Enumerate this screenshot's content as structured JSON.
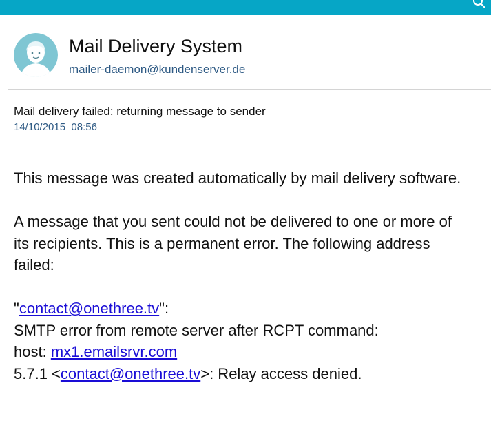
{
  "app_bar": {
    "color": "#06a6c6",
    "icon": "search-icon"
  },
  "sender": {
    "avatar_icon": "user-avatar-icon",
    "name": "Mail Delivery System",
    "email": "mailer-daemon@kundenserver.de"
  },
  "message": {
    "subject": "Mail delivery failed: returning message to sender",
    "date": "14/10/2015",
    "time": "08:56",
    "date_time": "14/10/2015  08:56"
  },
  "body": {
    "intro": "This message was created automatically by mail delivery software.",
    "paragraph_line1": "A message that you sent could not be delivered to one or more of",
    "paragraph_line2": "its recipients. This is a permanent error. The following address",
    "paragraph_line3": "failed:",
    "quote_open": "\"",
    "failed_address": "contact@onethree.tv",
    "quote_close": "\":",
    "smtp_error": "SMTP error from remote server after RCPT command:",
    "host_label": "host: ",
    "host": "mx1.emailsrvr.com",
    "code_prefix": "5.7.1 <",
    "code_address": "contact@onethree.tv",
    "code_suffix": ">: Relay access denied."
  },
  "colors": {
    "accent": "#06a6c6",
    "link": "#1a0dd6",
    "meta_text": "#2e5a84"
  }
}
